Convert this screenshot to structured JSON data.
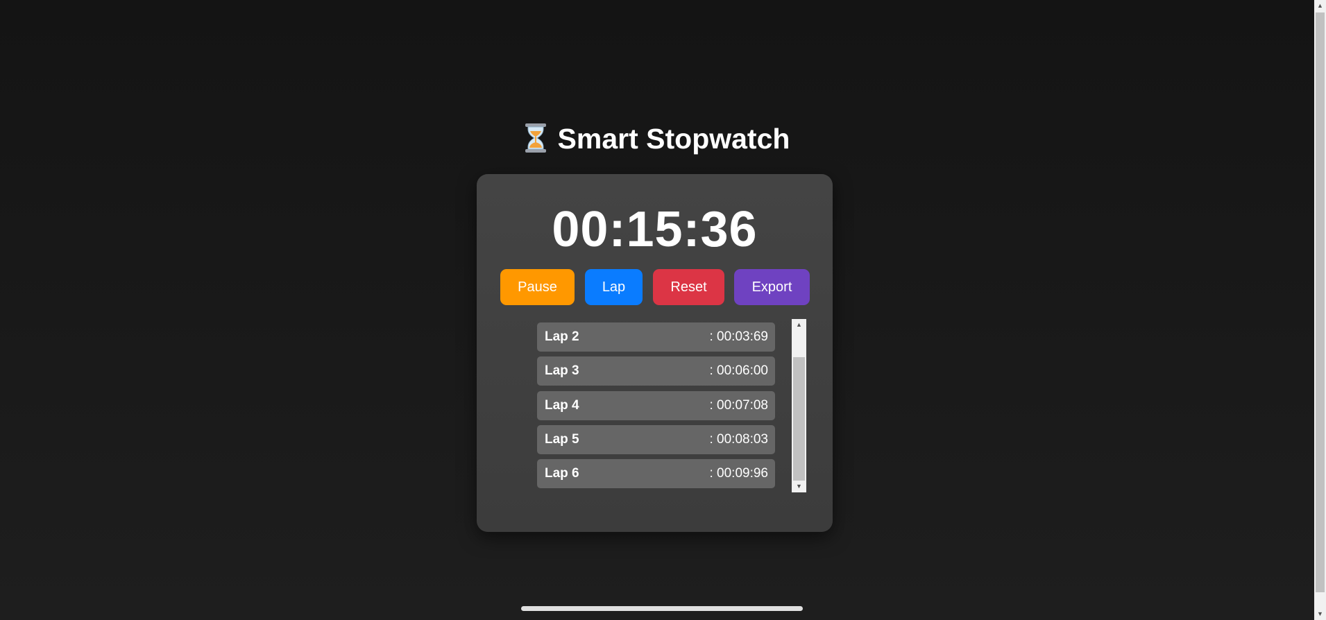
{
  "header": {
    "icon": "hourglass-icon",
    "title": "Smart Stopwatch"
  },
  "timer": {
    "display": "00:15:36"
  },
  "controls": {
    "pause_label": "Pause",
    "lap_label": "Lap",
    "reset_label": "Reset",
    "export_label": "Export"
  },
  "laps": [
    {
      "name": "Lap 2",
      "time": ": 00:03:69"
    },
    {
      "name": "Lap 3",
      "time": ": 00:06:00"
    },
    {
      "name": "Lap 4",
      "time": ": 00:07:08"
    },
    {
      "name": "Lap 5",
      "time": ": 00:08:03"
    },
    {
      "name": "Lap 6",
      "time": ": 00:09:96"
    }
  ],
  "colors": {
    "pause": "#ff9800",
    "lap": "#0a7cff",
    "reset": "#dc3545",
    "export": "#6f42c1",
    "card": "#444444",
    "lap_row": "#666666"
  }
}
